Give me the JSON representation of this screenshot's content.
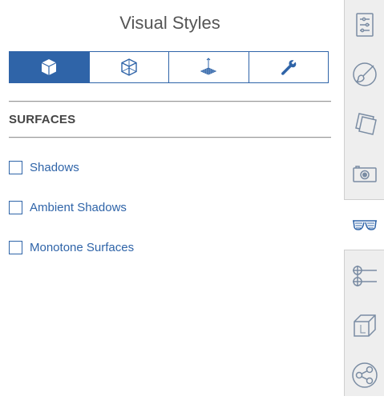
{
  "panel": {
    "title": "Visual Styles",
    "tabs": [
      {
        "icon": "solid-cube-icon",
        "active": true
      },
      {
        "icon": "wireframe-cube-icon",
        "active": false
      },
      {
        "icon": "axes-grid-icon",
        "active": false
      },
      {
        "icon": "wrench-icon",
        "active": false
      }
    ],
    "section_title": "SURFACES",
    "options": [
      {
        "label": "Shadows",
        "checked": false
      },
      {
        "label": "Ambient Shadows",
        "checked": false
      },
      {
        "label": "Monotone Surfaces",
        "checked": false
      }
    ]
  },
  "sidebar": {
    "items": [
      {
        "icon": "outliner-list-icon",
        "active": false
      },
      {
        "icon": "paint-brush-icon",
        "active": false
      },
      {
        "icon": "layers-icon",
        "active": false
      },
      {
        "icon": "camera-icon",
        "active": false
      },
      {
        "icon": "glasses-icon",
        "active": true
      },
      {
        "icon": "sliders-icon",
        "active": false
      },
      {
        "icon": "extrude-box-icon",
        "active": false
      },
      {
        "icon": "share-icon",
        "active": false
      }
    ]
  },
  "colors": {
    "accent": "#2f64a8",
    "sidebar_bg": "#eeeeee",
    "icon_gray": "#7a8ca3"
  }
}
